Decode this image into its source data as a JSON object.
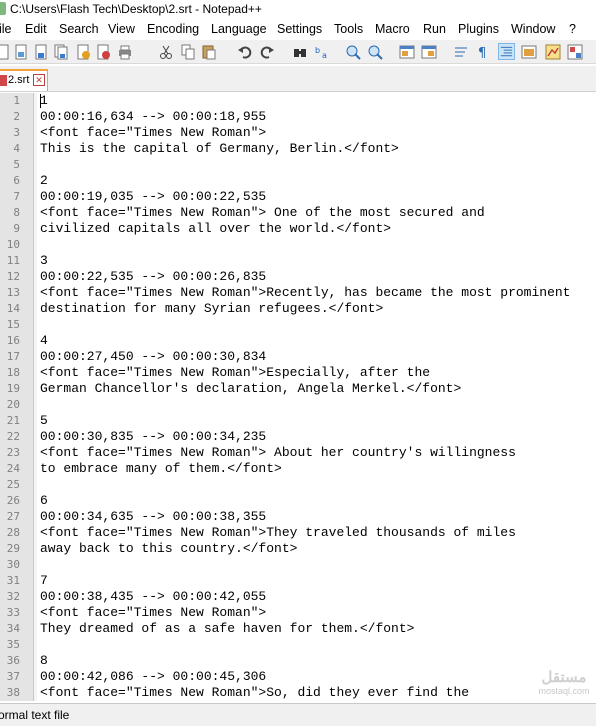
{
  "window": {
    "title": "C:\\Users\\Flash Tech\\Desktop\\2.srt - Notepad++"
  },
  "menu": [
    {
      "label": "ile"
    },
    {
      "label": "Edit"
    },
    {
      "label": "Search"
    },
    {
      "label": "View"
    },
    {
      "label": "Encoding"
    },
    {
      "label": "Language"
    },
    {
      "label": "Settings"
    },
    {
      "label": "Tools"
    },
    {
      "label": "Macro"
    },
    {
      "label": "Run"
    },
    {
      "label": "Plugins"
    },
    {
      "label": "Window"
    },
    {
      "label": "?"
    }
  ],
  "toolbar": {
    "icons": [
      "new-file-icon",
      "open-file-icon",
      "save-icon",
      "save-all-icon",
      "close-icon",
      "close-all-icon",
      "print-icon",
      "cut-icon",
      "copy-icon",
      "paste-icon",
      "undo-icon",
      "redo-icon",
      "find-icon",
      "replace-icon",
      "zoom-in-icon",
      "zoom-out-icon",
      "sync-vertical-icon",
      "sync-horizontal-icon",
      "word-wrap-icon",
      "show-all-chars-icon",
      "indent-guide-icon",
      "doc-map-icon",
      "function-list-icon",
      "folder-workspace-icon"
    ]
  },
  "tabs": [
    {
      "label": "2.srt",
      "close": "✕"
    }
  ],
  "editor": {
    "lines": [
      "1",
      "00:00:16,634 --> 00:00:18,955",
      "<font face=\"Times New Roman\">",
      "This is the capital of Germany, Berlin.</font>",
      "",
      "2",
      "00:00:19,035 --> 00:00:22,535",
      "<font face=\"Times New Roman\"> One of the most secured and",
      "civilized capitals all over the world.</font>",
      "",
      "3",
      "00:00:22,535 --> 00:00:26,835",
      "<font face=\"Times New Roman\">Recently, has became the most prominent",
      "destination for many Syrian refugees.</font>",
      "",
      "4",
      "00:00:27,450 --> 00:00:30,834",
      "<font face=\"Times New Roman\">Especially, after the",
      "German Chancellor's declaration, Angela Merkel.</font>",
      "",
      "5",
      "00:00:30,835 --> 00:00:34,235",
      "<font face=\"Times New Roman\"> About her country's willingness",
      "to embrace many of them.</font>",
      "",
      "6",
      "00:00:34,635 --> 00:00:38,355",
      "<font face=\"Times New Roman\">They traveled thousands of miles",
      "away back to this country.</font>",
      "",
      "7",
      "00:00:38,435 --> 00:00:42,055",
      "<font face=\"Times New Roman\">",
      "They dreamed of as a safe haven for them.</font>",
      "",
      "8",
      "00:00:42,086 --> 00:00:45,306",
      "<font face=\"Times New Roman\">So, did they ever find the"
    ]
  },
  "status": {
    "file_type": "ormal text file"
  },
  "watermark": {
    "main": "مستقل",
    "sub": "mostaql.com"
  },
  "colors": {
    "gutter": "#e4e4e4",
    "line_number": "#808080",
    "tab_accent": "#f3a33a",
    "chrome": "#f0f0f0"
  }
}
